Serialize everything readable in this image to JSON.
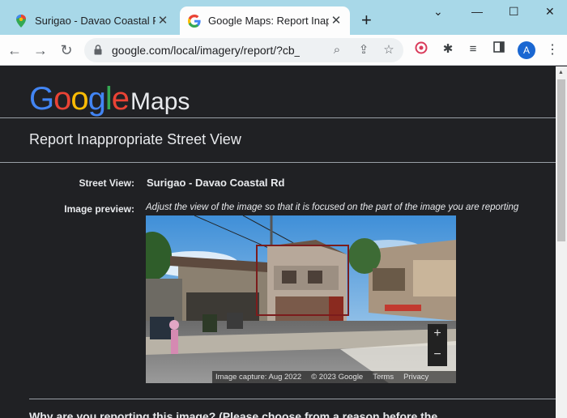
{
  "browser": {
    "tabs": [
      {
        "title": "Surigao - Davao Coastal Rd",
        "favicon": "maps-pin-icon",
        "active": false
      },
      {
        "title": "Google Maps: Report Inappr",
        "favicon": "google-g-icon",
        "active": true
      }
    ],
    "new_tab": "+",
    "window_controls": {
      "dropdown": "⌄",
      "minimize": "—",
      "maximize": "☐",
      "close": "✕"
    },
    "url": "google.com/local/imagery/report/?cb_cl...",
    "avatar_letter": "A"
  },
  "page": {
    "logo_letters": [
      "G",
      "o",
      "o",
      "g",
      "l",
      "e"
    ],
    "logo_colors": [
      "#4285f4",
      "#ea4335",
      "#fbbc05",
      "#4285f4",
      "#34a853",
      "#ea4335"
    ],
    "logo_suffix": "Maps",
    "heading": "Report Inappropriate Street View",
    "street_view_label": "Street View:",
    "street_view_value": "Surigao - Davao Coastal Rd",
    "preview_label": "Image preview:",
    "preview_instructions": "Adjust the view of the image so that it is focused on the part of the image you are reporting",
    "image_footer": {
      "capture": "Image capture: Aug 2022",
      "copyright": "© 2023 Google",
      "terms": "Terms",
      "privacy": "Privacy"
    },
    "zoom_in": "+",
    "zoom_out": "−",
    "bottom_question": "Why are you reporting this image? (Please choose from a reason before the..."
  }
}
